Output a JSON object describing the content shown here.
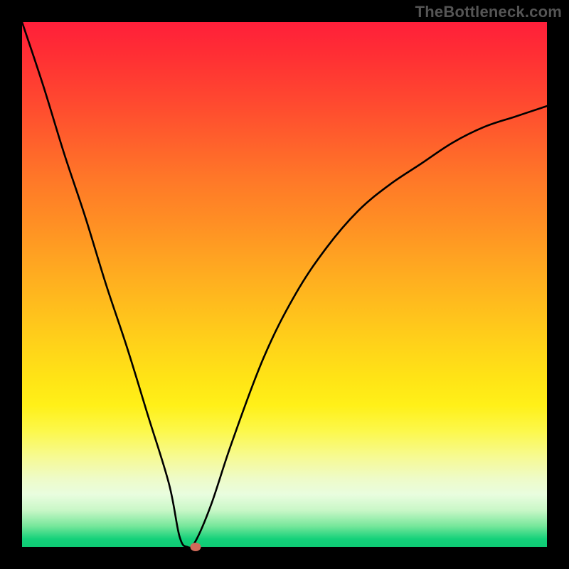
{
  "watermark": "TheBottleneck.com",
  "colors": {
    "page_bg": "#000000",
    "curve": "#000000",
    "marker": "#cf6a5a",
    "watermark": "#555555"
  },
  "chart_data": {
    "type": "line",
    "title": "",
    "xlabel": "",
    "ylabel": "",
    "xlim": [
      0,
      100
    ],
    "ylim": [
      0,
      100
    ],
    "grid": false,
    "axes_visible": false,
    "legend": false,
    "series": [
      {
        "name": "curve",
        "x": [
          0,
          4,
          8,
          12,
          16,
          20,
          24,
          28,
          30,
          31.5,
          33,
          36,
          40,
          46,
          52,
          58,
          64,
          70,
          76,
          82,
          88,
          94,
          100
        ],
        "y": [
          100,
          88,
          75,
          63,
          50,
          38,
          25,
          12,
          2,
          0,
          1,
          8,
          20,
          36,
          48,
          57,
          64,
          69,
          73,
          77,
          80,
          82,
          84
        ]
      }
    ],
    "marker": {
      "x": 33,
      "y": 0
    },
    "notes": "Y values estimated from visual position on the gradient (0=bottom/green, 100=top/red). Curve drops steeply from top-left to ~x=31.5 (minimum), then rises concavely toward upper-right."
  }
}
